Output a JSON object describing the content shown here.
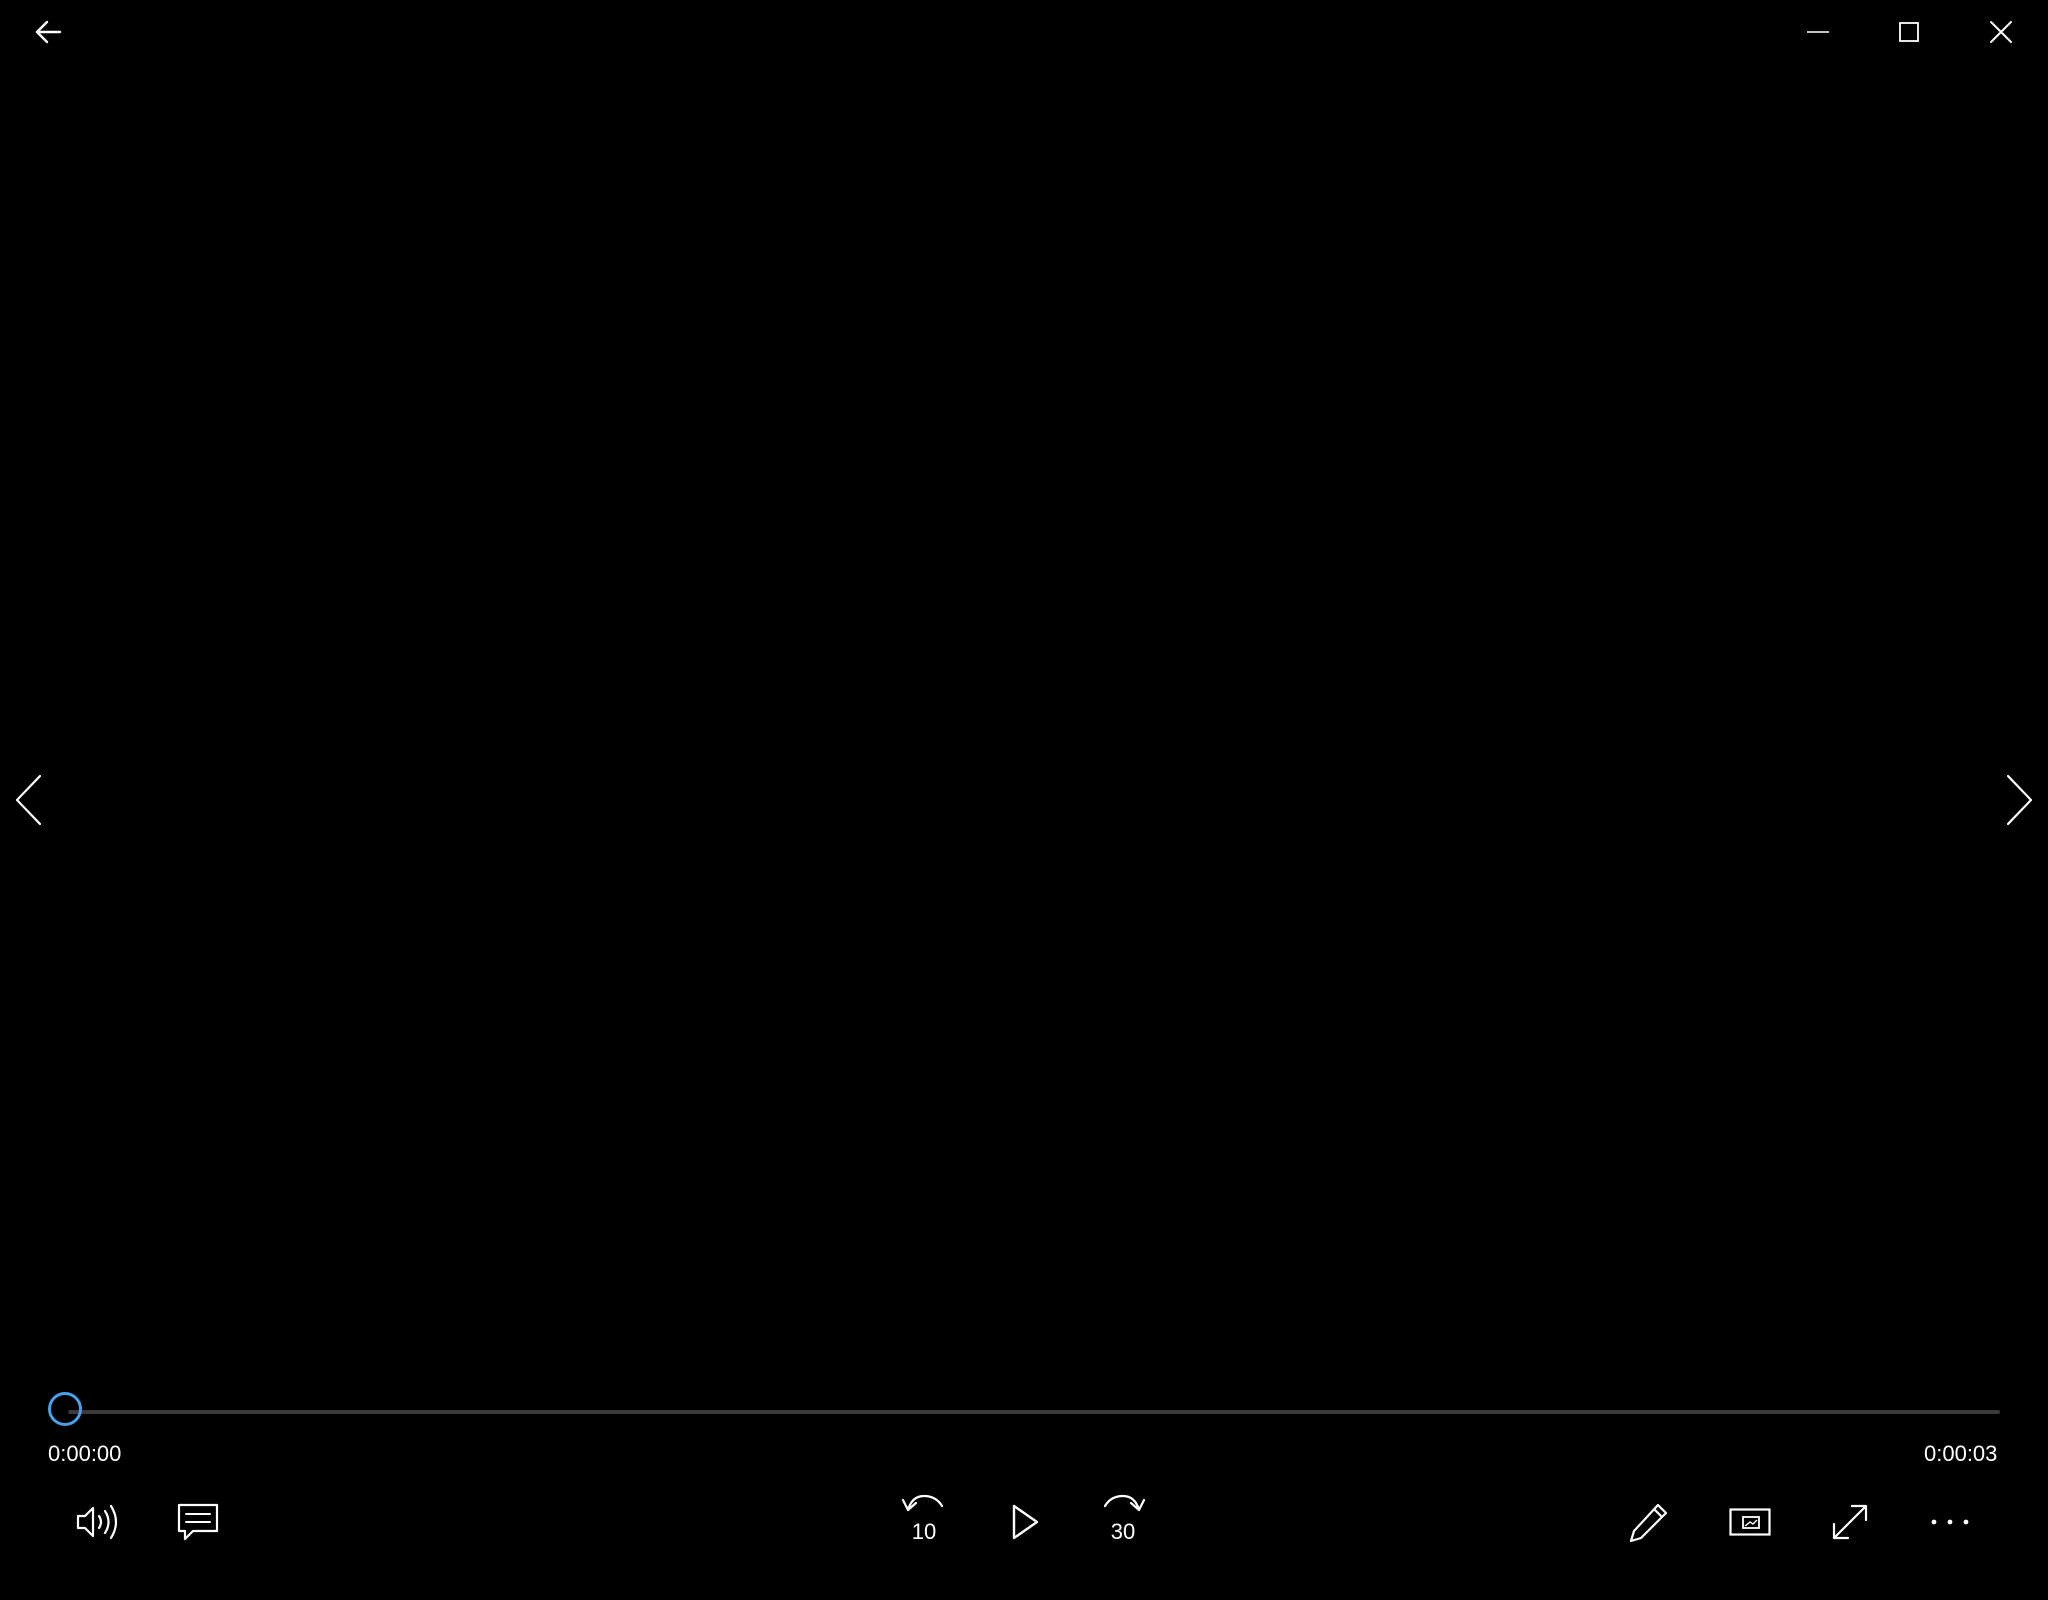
{
  "window": {
    "controls": [
      "back",
      "minimize",
      "maximize",
      "close"
    ]
  },
  "playback": {
    "current_time": "0:00:00",
    "total_time": "0:00:03",
    "progress": 0.0
  },
  "controls": {
    "skip_back_seconds": "10",
    "skip_forward_seconds": "30"
  },
  "icons": {
    "back": "arrow-left-icon",
    "minimize": "minimize-icon",
    "maximize": "maximize-icon",
    "close": "close-icon",
    "previous": "chevron-left-icon",
    "next": "chevron-right-icon",
    "volume": "volume-icon",
    "captions": "captions-icon",
    "rewind": "rewind-icon",
    "play": "play-icon",
    "forward": "forward-icon",
    "edit": "pencil-icon",
    "mini_view": "mini-view-icon",
    "fullscreen": "fullscreen-icon",
    "more": "more-icon"
  },
  "colors": {
    "background": "#000000",
    "accent": "#4a9fe8",
    "track": "#3a3a3a",
    "foreground": "#ffffff"
  }
}
